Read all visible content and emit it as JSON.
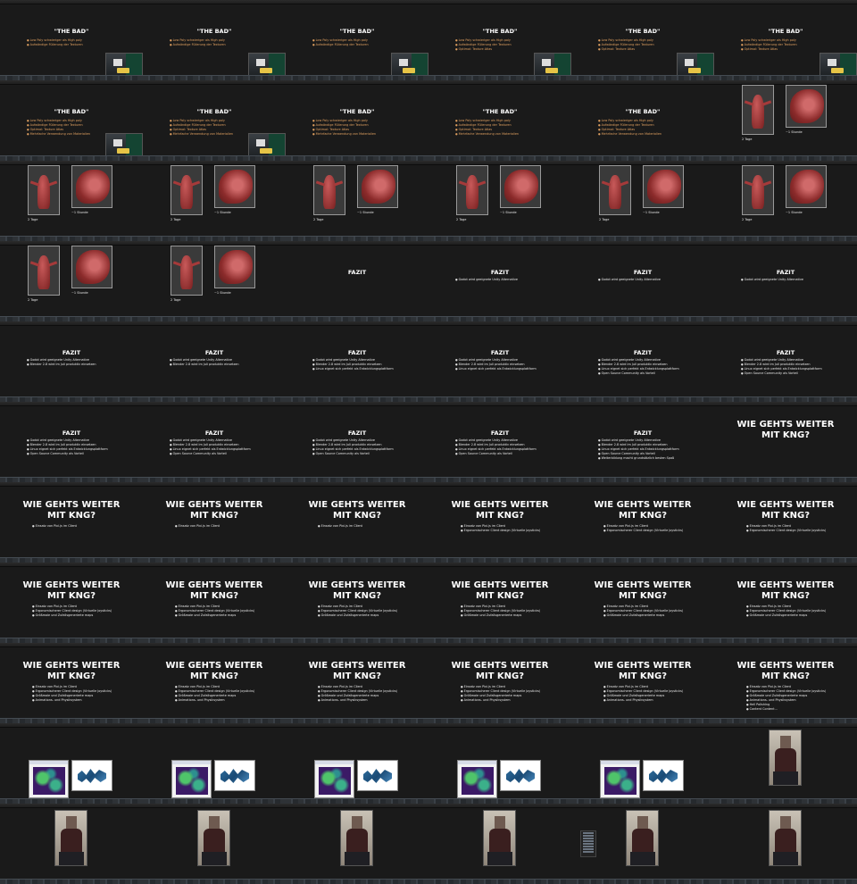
{
  "grid": {
    "columns": 6,
    "rows": 11
  },
  "texts": {
    "the_bad": "\"THE BAD\"",
    "fazit": "FAZIT",
    "kng_line1": "WIE GEHTS WEITER",
    "kng_line2": "MIT KNG?",
    "caption_tage": "2 Tage",
    "caption_stunde": "~1 Stunde"
  },
  "bullets": {
    "bad": [
      "Low Poly schwieriger als High poly",
      "Aufwändige Füllerung der Texturen",
      "Optimal: Texture Atlas",
      "Mehrfache Verwendung von Materialien"
    ],
    "fazit": [
      "Godot wird geeignete Unity Alternative",
      "Blender 2.8 wird im Juli produktiv einsetzen",
      "Linux eignet sich perfekt als Entwicklungsplattform",
      "Open Source Community als Vorteil",
      "Weiterbildung macht grundsätzlich besten Spaß"
    ],
    "kng": [
      "Einsatz von Pixi.js im Client",
      "Ergonomischerer Client design (Virtuelle Joysticks)",
      "Größmaie und Zufallsgenerierte maps",
      "Animations- und Physiksystem",
      "Hell Polishing",
      "Content Content..."
    ]
  },
  "slides": [
    {
      "type": "bad",
      "count": 2,
      "video": true
    },
    {
      "type": "bad",
      "count": 2,
      "video": true
    },
    {
      "type": "bad",
      "count": 2,
      "video": true
    },
    {
      "type": "bad",
      "count": 3,
      "video": true
    },
    {
      "type": "bad",
      "count": 3,
      "video": true
    },
    {
      "type": "bad",
      "count": 3,
      "video": true
    },
    {
      "type": "bad",
      "count": 4,
      "video": true
    },
    {
      "type": "bad",
      "count": 4,
      "video": true
    },
    {
      "type": "bad",
      "count": 4,
      "video": false
    },
    {
      "type": "bad",
      "count": 4,
      "video": false
    },
    {
      "type": "bad",
      "count": 4,
      "video": false
    },
    {
      "type": "model"
    },
    {
      "type": "model"
    },
    {
      "type": "model"
    },
    {
      "type": "model"
    },
    {
      "type": "model"
    },
    {
      "type": "model"
    },
    {
      "type": "model"
    },
    {
      "type": "model"
    },
    {
      "type": "model"
    },
    {
      "type": "fazit",
      "count": 0
    },
    {
      "type": "fazit",
      "count": 1
    },
    {
      "type": "fazit",
      "count": 1
    },
    {
      "type": "fazit",
      "count": 1
    },
    {
      "type": "fazit",
      "count": 2
    },
    {
      "type": "fazit",
      "count": 2
    },
    {
      "type": "fazit",
      "count": 3
    },
    {
      "type": "fazit",
      "count": 3
    },
    {
      "type": "fazit",
      "count": 4
    },
    {
      "type": "fazit",
      "count": 4
    },
    {
      "type": "fazit",
      "count": 4
    },
    {
      "type": "fazit",
      "count": 4
    },
    {
      "type": "fazit",
      "count": 4
    },
    {
      "type": "fazit",
      "count": 4
    },
    {
      "type": "fazit",
      "count": 5
    },
    {
      "type": "kng",
      "count": 0
    },
    {
      "type": "kng",
      "count": 1
    },
    {
      "type": "kng",
      "count": 1
    },
    {
      "type": "kng",
      "count": 1
    },
    {
      "type": "kng",
      "count": 2
    },
    {
      "type": "kng",
      "count": 2
    },
    {
      "type": "kng",
      "count": 2
    },
    {
      "type": "kng",
      "count": 3
    },
    {
      "type": "kng",
      "count": 3
    },
    {
      "type": "kng",
      "count": 3
    },
    {
      "type": "kng",
      "count": 3
    },
    {
      "type": "kng",
      "count": 3
    },
    {
      "type": "kng",
      "count": 3
    },
    {
      "type": "kng",
      "count": 4
    },
    {
      "type": "kng",
      "count": 4
    },
    {
      "type": "kng",
      "count": 4
    },
    {
      "type": "kng",
      "count": 4
    },
    {
      "type": "kng",
      "count": 4
    },
    {
      "type": "kng",
      "count": 6
    },
    {
      "type": "graph"
    },
    {
      "type": "graph"
    },
    {
      "type": "graph"
    },
    {
      "type": "graph"
    },
    {
      "type": "graph"
    },
    {
      "type": "person"
    },
    {
      "type": "person"
    },
    {
      "type": "person"
    },
    {
      "type": "person"
    },
    {
      "type": "person"
    },
    {
      "type": "person",
      "menu": true
    },
    {
      "type": "person"
    }
  ]
}
